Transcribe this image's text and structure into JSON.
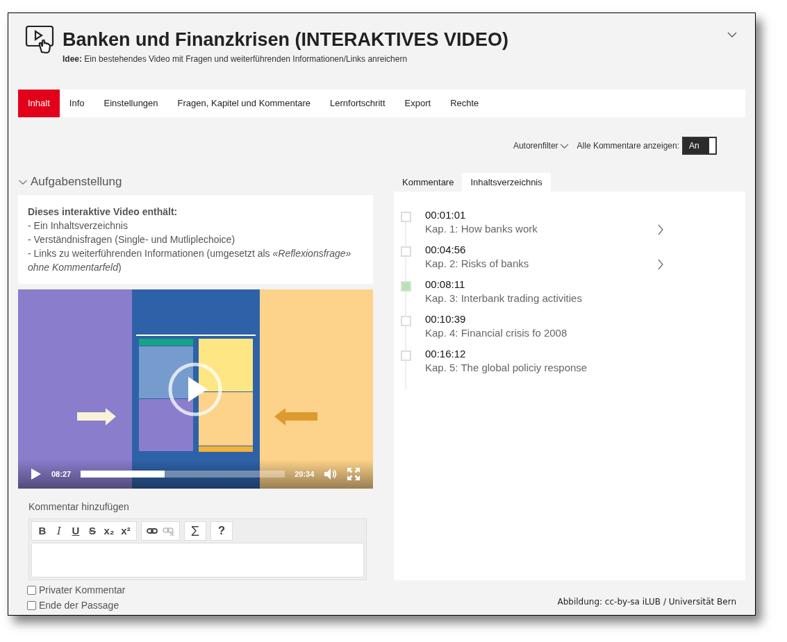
{
  "header": {
    "title": "Banken und Finanzkrisen (INTERAKTIVES VIDEO)",
    "idea_label": "Idee:",
    "idea_text": "Ein bestehendes Video mit Fragen und weiterführenden Informationen/Links anreichern"
  },
  "tabs": [
    {
      "label": "Inhalt",
      "selected": true
    },
    {
      "label": "Info",
      "selected": false
    },
    {
      "label": "Einstellungen",
      "selected": false
    },
    {
      "label": "Fragen, Kapitel und Kommentare",
      "selected": false
    },
    {
      "label": "Lernfortschritt",
      "selected": false
    },
    {
      "label": "Export",
      "selected": false
    },
    {
      "label": "Rechte",
      "selected": false
    }
  ],
  "filter": {
    "author_filter": "Autorenfilter",
    "show_all_label": "Alle Kommentare anzeigen:",
    "toggle": {
      "label": "An",
      "on": true
    }
  },
  "task": {
    "heading": "Aufgabenstellung",
    "expanded": true,
    "intro": "Dieses interaktive Video enthält:",
    "lines": [
      "- Ein Inhaltsverzeichnis",
      "- Verständnisfragen (Single- und Mutliplechoice)",
      "- Links zu weiterführenden Informationen (umgesetzt als *«Reflexionsfrage» ohne Kommentarfeld*)"
    ]
  },
  "video": {
    "playing": false,
    "current_time": "08:27",
    "duration": "20:34",
    "progress": {
      "level": 0.41
    }
  },
  "comment": {
    "label": "Kommentar hinzufügen",
    "toolbar": [
      [
        {
          "kind": "bold",
          "label": "B",
          "disabled": false
        },
        {
          "kind": "italic",
          "label": "I",
          "disabled": false
        },
        {
          "kind": "underline",
          "label": "U",
          "disabled": false
        },
        {
          "kind": "strike",
          "label": "S",
          "disabled": false
        },
        {
          "kind": "subscript",
          "label": "x₂",
          "disabled": false
        },
        {
          "kind": "superscript",
          "label": "x²",
          "disabled": false
        }
      ],
      [
        {
          "kind": "link",
          "disabled": false
        },
        {
          "kind": "unlink",
          "disabled": true
        }
      ],
      [
        {
          "kind": "formula",
          "label": "Σ",
          "disabled": false
        }
      ],
      [
        {
          "kind": "help",
          "label": "?",
          "disabled": false
        }
      ]
    ],
    "options": [
      {
        "label": "Privater Kommentar",
        "checked": false
      },
      {
        "label": "Ende der Passage",
        "checked": false
      }
    ]
  },
  "side_tabs": [
    {
      "label": "Kommentare",
      "selected": false
    },
    {
      "label": "Inhaltsverzeichnis",
      "selected": true
    }
  ],
  "chapters": [
    {
      "time": "00:01:01",
      "title": "Kap. 1: How banks work",
      "active": false,
      "expandable": true
    },
    {
      "time": "00:04:56",
      "title": "Kap. 2: Risks of banks",
      "active": false,
      "expandable": true
    },
    {
      "time": "00:08:11",
      "title": "Kap. 3: Interbank trading activities",
      "active": true,
      "expandable": false
    },
    {
      "time": "00:10:39",
      "title": "Kap. 4: Financial crisis fo 2008",
      "active": false,
      "expandable": false
    },
    {
      "time": "00:16:12",
      "title": "Kap. 5: The global policiy response",
      "active": false,
      "expandable": false
    }
  ],
  "caption": "Abbildung: cc-by-sa iLUB / Universität Bern"
}
